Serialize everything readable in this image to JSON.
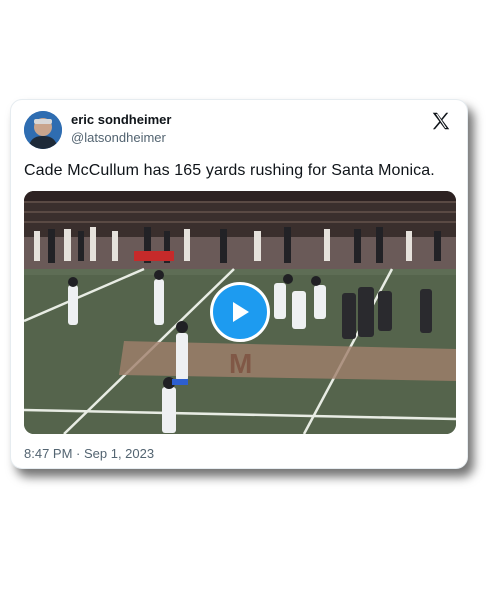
{
  "tweet": {
    "author_name": "eric sondheimer",
    "author_handle": "@latsondheimer",
    "text": "Cade McCullum has 165 yards rushing for Santa Monica.",
    "timestamp": "8:47 PM · Sep 1, 2023"
  },
  "icons": {
    "platform_logo": "x-logo-icon",
    "play": "play-icon"
  },
  "colors": {
    "accent": "#1d9bf0",
    "name_text": "#0f1419",
    "secondary_text": "#536471"
  }
}
